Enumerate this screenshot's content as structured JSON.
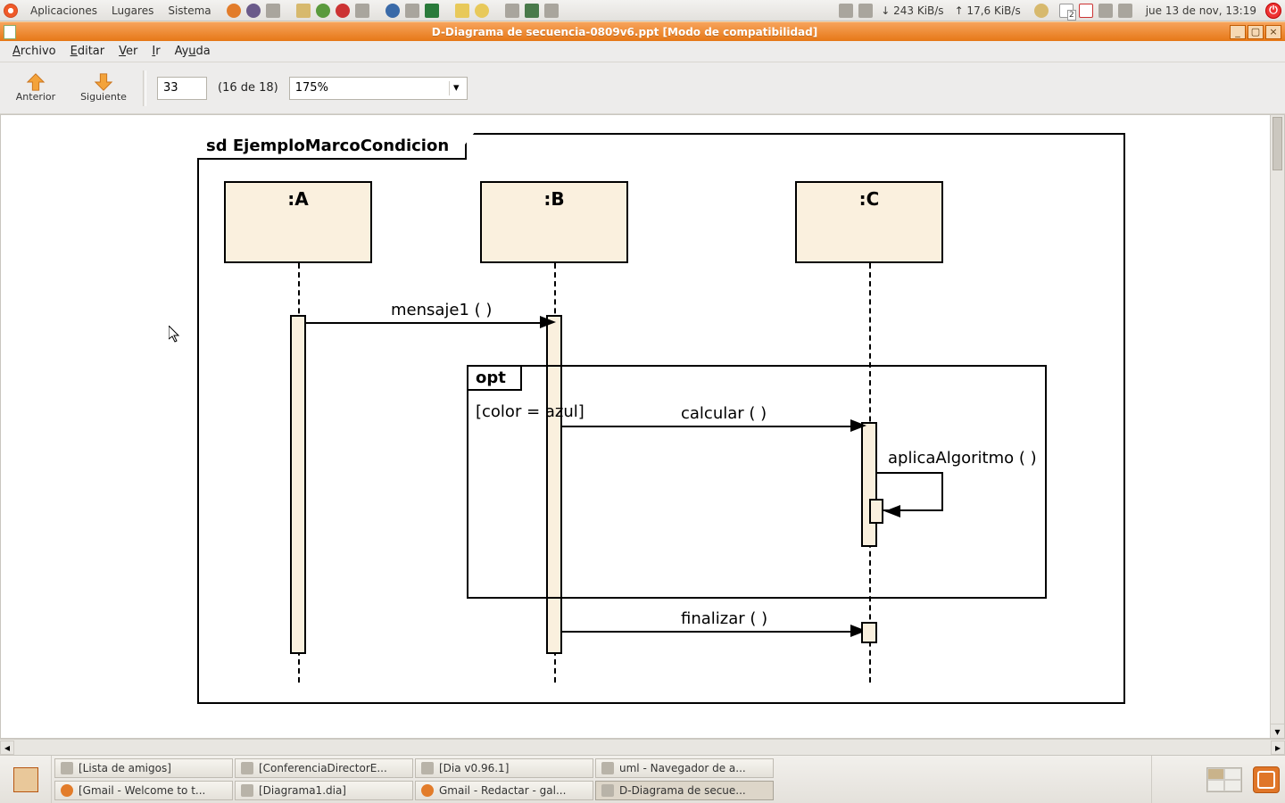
{
  "top_panel": {
    "menus": [
      "Aplicaciones",
      "Lugares",
      "Sistema"
    ],
    "net_down": "↓ 243 KiB/s",
    "net_up": "↑ 17,6 KiB/s",
    "mail_badge": "2",
    "clock": "jue 13 de nov, 13:19"
  },
  "window": {
    "title": "D-Diagrama de secuencia-0809v6.ppt [Modo de compatibilidad]",
    "min": "_",
    "max": "▢",
    "close": "×"
  },
  "menubar": {
    "archivo": "Archivo",
    "editar": "Editar",
    "ver": "Ver",
    "ir": "Ir",
    "ayuda": "Ayuda"
  },
  "toolbar": {
    "prev": "Anterior",
    "next": "Siguiente",
    "page_value": "33",
    "page_of": "(16 de 18)",
    "zoom": "175%"
  },
  "diagram": {
    "frame_label": "sd  EjemploMarcoCondicion",
    "lifelines": {
      "a": ":A",
      "b": ":B",
      "c": ":C"
    },
    "msg1": "mensaje1 ( )",
    "opt_label": "opt",
    "guard": "[color = azul]",
    "msg_calc": "calcular ( )",
    "msg_algo": "aplicaAlgoritmo ( )",
    "msg_fin": "finalizar ( )"
  },
  "taskbar": {
    "t1": "[Lista de amigos]",
    "t2": "[ConferenciaDirectorE...",
    "t3": "[Dia v0.96.1]",
    "t4": "uml - Navegador de a...",
    "t5": "[Gmail - Welcome to t...",
    "t6": "[Diagrama1.dia]",
    "t7": "Gmail - Redactar - gal...",
    "t8": "D-Diagrama de secue..."
  }
}
